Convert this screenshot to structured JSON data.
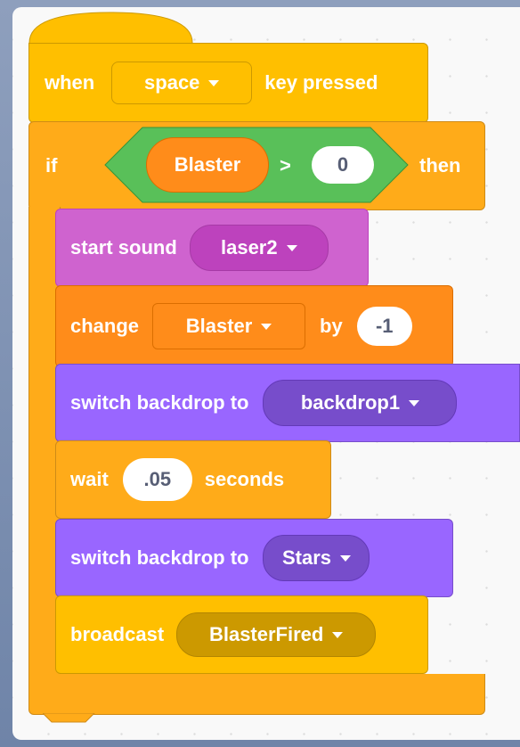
{
  "hat": {
    "when_label": "when",
    "key_value": "space",
    "key_pressed_label": "key pressed"
  },
  "if_block": {
    "if_label": "if",
    "then_label": "then",
    "variable": "Blaster",
    "operator": ">",
    "compare_value": "0"
  },
  "sound_block": {
    "label": "start sound",
    "value": "laser2"
  },
  "change_block": {
    "label": "change",
    "variable": "Blaster",
    "by_label": "by",
    "value": "-1"
  },
  "backdrop1_block": {
    "label": "switch backdrop to",
    "value": "backdrop1"
  },
  "wait_block": {
    "label": "wait",
    "value": ".05",
    "seconds_label": "seconds"
  },
  "backdrop2_block": {
    "label": "switch backdrop to",
    "value": "Stars"
  },
  "broadcast_block": {
    "label": "broadcast",
    "value": "BlasterFired"
  },
  "colors": {
    "events": "#ffbf00",
    "control": "#ffab19",
    "sound": "#cf63cf",
    "variables": "#ff8c1a",
    "looks": "#9966ff",
    "operators": "#59c059"
  }
}
